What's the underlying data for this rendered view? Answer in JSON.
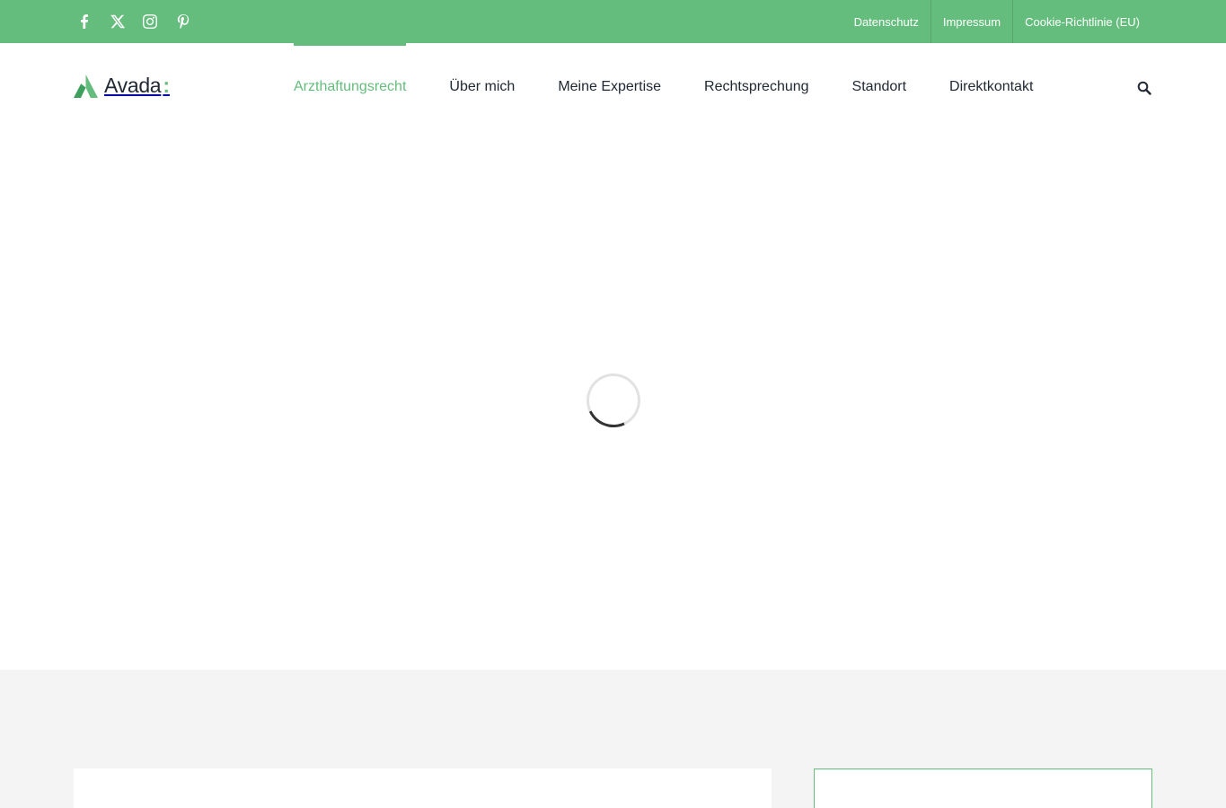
{
  "colors": {
    "accent": "#65bd7d",
    "text": "#212934",
    "band": "#f4f4f4"
  },
  "topbar": {
    "social": [
      {
        "name": "facebook",
        "icon": "facebook-icon"
      },
      {
        "name": "x",
        "icon": "x-twitter-icon"
      },
      {
        "name": "instagram",
        "icon": "instagram-icon"
      },
      {
        "name": "pinterest",
        "icon": "pinterest-icon"
      }
    ],
    "links": [
      "Datenschutz",
      "Impressum",
      "Cookie-Richtlinie (EU)"
    ]
  },
  "header": {
    "logo_text": "Avada",
    "logo_colon": ":",
    "nav": [
      {
        "label": "Arzthaftungsrecht",
        "active": true
      },
      {
        "label": "Über mich",
        "active": false
      },
      {
        "label": "Meine Expertise",
        "active": false
      },
      {
        "label": "Rechtsprechung",
        "active": false
      },
      {
        "label": "Standort",
        "active": false
      },
      {
        "label": "Direktkontakt",
        "active": false
      }
    ],
    "search_icon": "search-icon"
  },
  "main": {
    "loading": true,
    "loader_icon": "spinner-icon"
  }
}
